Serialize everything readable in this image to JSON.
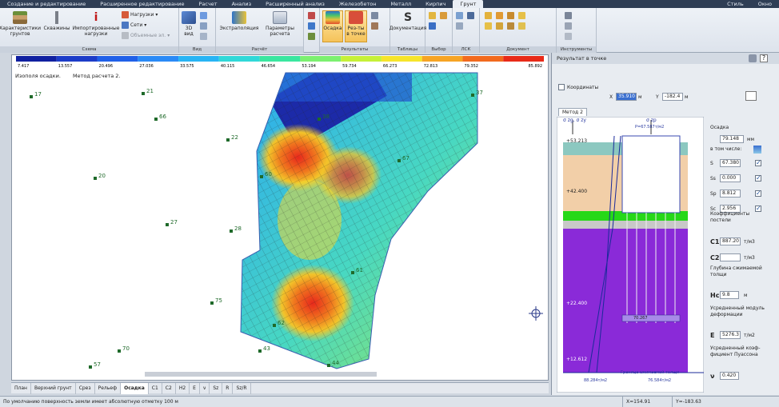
{
  "menu": {
    "tabs": [
      "Создание и редактирование",
      "Расширенное редактирование",
      "Расчет",
      "Анализ",
      "Расширенный анализ",
      "Железобетон",
      "Металл",
      "Кирпич",
      "Грунт"
    ],
    "active_tab": "Грунт",
    "right_items": [
      "Стиль",
      "Окно"
    ]
  },
  "ribbon": {
    "groups": {
      "schemes": "Схема",
      "view": "Вид",
      "calc": "Расчёт",
      "results": "Результаты",
      "tables": "Таблицы",
      "doc": "Документ",
      "tools": "Инструменты",
      "select": "Выбор",
      "lsk": "ЛСК"
    },
    "buttons": {
      "soil_chars": "Характеристики грунтов",
      "wells": "Скважины",
      "import_loads": "Импортированные нагрузки",
      "loads": "Нагрузки",
      "nets": "Сети",
      "volume_elems": "Объемные эл.",
      "view3d": "3D вид",
      "extrapolation": "Экстраполяция",
      "calc_params": "Параметры расчета",
      "settlement": "Осадка",
      "res_in_point": "Рез-ты в точке",
      "tables_btn": "Таблицы",
      "documentation": "Документация"
    }
  },
  "scale": {
    "colors": [
      "#1020a0",
      "#1c3cc8",
      "#2060e8",
      "#2a8af6",
      "#28b4f4",
      "#30d8d8",
      "#3ae6a0",
      "#7cf070",
      "#c6f038",
      "#f6e42a",
      "#f6a424",
      "#f26a1e",
      "#e82a18"
    ],
    "ticks": [
      "7.417",
      "13.557",
      "20.496",
      "27.036",
      "33.575",
      "40.115",
      "46.654",
      "53.194",
      "59.734",
      "66.273",
      "72.813",
      "79.352",
      "85.892"
    ]
  },
  "canvas": {
    "header_left": "Изополя осадки.",
    "header_right": "Метод расчета 2.",
    "wells": [
      {
        "id": "17"
      },
      {
        "id": "21"
      },
      {
        "id": "66"
      },
      {
        "id": "22"
      },
      {
        "id": "20"
      },
      {
        "id": "27"
      },
      {
        "id": "28"
      },
      {
        "id": "75"
      },
      {
        "id": "70"
      },
      {
        "id": "57"
      },
      {
        "id": "67"
      },
      {
        "id": "60"
      },
      {
        "id": "61"
      },
      {
        "id": "62"
      },
      {
        "id": "43"
      },
      {
        "id": "44"
      },
      {
        "id": "37"
      },
      {
        "id": "38"
      }
    ]
  },
  "view_tabs": [
    "План",
    "Верхний грунт",
    "Срез",
    "Рельеф",
    "Осадка",
    "C1",
    "C2",
    "H2",
    "E",
    "ν",
    "Sz",
    "R",
    "Sz/R"
  ],
  "active_view_tab": "Осадка",
  "panel": {
    "title": "Результат в точке",
    "coords_label": "Координаты",
    "x_label": "X",
    "x_value": "35.910",
    "y_label": "Y",
    "y_value": "-182.4",
    "unit_m": "м",
    "method_tab": "Метод 2",
    "col_labels": {
      "left": "σ zg, σ zy",
      "right": "σ zp"
    },
    "levels": {
      "top": "+53.213",
      "mid": "+42.400",
      "low": "+22.400",
      "bottom": "+12.612"
    },
    "p_label": "P=67.587т/м2",
    "stress_label": "70.267",
    "bottom_left": "88.284т/м2",
    "bottom_right": "76.584т/м2",
    "bottom_caption": "Граница сжимаемой толщи",
    "side_texts": [
      "Осадка",
      "в том числе:",
      "Коэффициенты постели",
      "Глубина сжимаемой толщи",
      "Усредненный модуль деформации",
      "Усредненный коэф-фициент Пуассона"
    ],
    "settlement": "79.148",
    "settlement_unit": "мм",
    "s_items": [
      {
        "name": "S",
        "value": "67.380",
        "checked": true
      },
      {
        "name": "Ss",
        "value": "0.000",
        "checked": true
      },
      {
        "name": "Sp",
        "value": "8.812",
        "checked": true
      },
      {
        "name": "Sc",
        "value": "2.956",
        "checked": true
      }
    ],
    "c1_label": "C1",
    "c1_value": "887.20",
    "c1_unit": "т/м3",
    "c2_label": "C2",
    "c2_value": "",
    "c2_unit": "т/м3",
    "h_label": "Hc",
    "h_value": "9.8",
    "h_unit": "м",
    "e_label": "E",
    "e_value": "5276.3",
    "e_unit": "т/м2",
    "nu_label": "ν",
    "nu_value": "0.420"
  },
  "status": {
    "text": "По умолчанию поверхность земли имеет абсолютную отметку 100 м",
    "x": "X=154.91",
    "y": "Y=-183.63"
  }
}
